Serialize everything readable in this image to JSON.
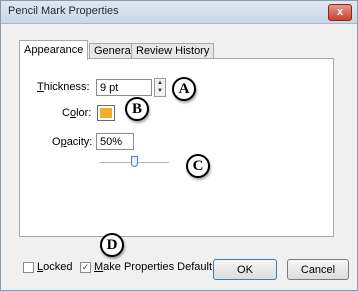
{
  "window": {
    "title": "Pencil Mark Properties",
    "close_label": "x"
  },
  "tabs": [
    {
      "label": "Appearance",
      "active": true
    },
    {
      "label": "General",
      "active": false
    },
    {
      "label": "Review History",
      "active": false
    }
  ],
  "appearance": {
    "thickness_label_first": "T",
    "thickness_label_rest": "hickness:",
    "thickness_value": "9 pt",
    "color_label_pre": "C",
    "color_label_under": "o",
    "color_label_post": "lor:",
    "color_value": "#eead2a",
    "opacity_label_pre": "O",
    "opacity_label_under": "p",
    "opacity_label_post": "acity:",
    "opacity_value": "50%",
    "opacity_slider_fraction": 0.5
  },
  "markers": [
    "A",
    "B",
    "C",
    "D"
  ],
  "footer": {
    "locked_label_under": "L",
    "locked_label_rest": "ocked",
    "locked_checked": false,
    "default_label_under": "M",
    "default_label_rest": "ake Properties Default",
    "default_checked": true,
    "check_glyph": "✓",
    "ok_label": "OK",
    "cancel_label": "Cancel"
  }
}
